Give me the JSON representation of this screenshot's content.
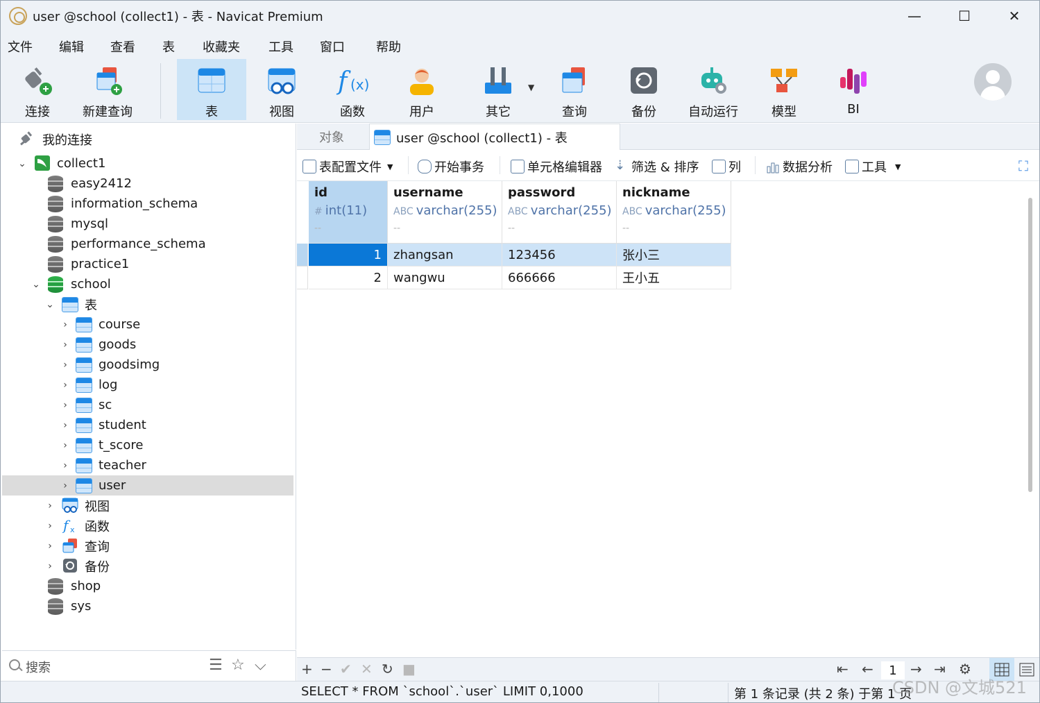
{
  "window": {
    "title": "user @school (collect1) - 表 - Navicat Premium",
    "controls": {
      "minimize": "—",
      "maximize": "☐",
      "close": "✕"
    }
  },
  "menu": [
    "文件",
    "编辑",
    "查看",
    "表",
    "收藏夹",
    "工具",
    "窗口",
    "帮助"
  ],
  "toolbar": {
    "buttons": [
      {
        "label": "连接",
        "icon": "connection-plug-icon"
      },
      {
        "label": "新建查询",
        "icon": "new-query-icon"
      },
      {
        "label": "表",
        "icon": "table-icon",
        "active": true
      },
      {
        "label": "视图",
        "icon": "view-icon"
      },
      {
        "label": "函数",
        "icon": "function-icon"
      },
      {
        "label": "用户",
        "icon": "user-icon"
      },
      {
        "label": "其它",
        "icon": "other-tools-icon"
      },
      {
        "label": "查询",
        "icon": "query-icon"
      },
      {
        "label": "备份",
        "icon": "backup-icon"
      },
      {
        "label": "自动运行",
        "icon": "robot-icon"
      },
      {
        "label": "模型",
        "icon": "model-icon"
      },
      {
        "label": "BI",
        "icon": "bi-icon"
      }
    ]
  },
  "sidebar": {
    "root_label": "我的连接",
    "connection": "collect1",
    "databases_before": [
      "easy2412",
      "information_schema",
      "mysql",
      "performance_schema",
      "practice1"
    ],
    "school": {
      "label": "school",
      "tables_label": "表",
      "tables": [
        "course",
        "goods",
        "goodsimg",
        "log",
        "sc",
        "student",
        "t_score",
        "teacher",
        "user"
      ],
      "selected_table": "user",
      "groups": [
        "视图",
        "函数",
        "查询",
        "备份"
      ]
    },
    "databases_after": [
      "shop",
      "sys"
    ],
    "search_label": "搜索"
  },
  "tabs": {
    "objects": "对象",
    "active": "user @school (collect1) - 表"
  },
  "subtoolbar": {
    "table_profile": "表配置文件",
    "begin_transaction": "开始事务",
    "cell_editor": "单元格编辑器",
    "filter_sort": "筛选 & 排序",
    "columns": "列",
    "data_analysis": "数据分析",
    "tools": "工具"
  },
  "grid": {
    "columns": [
      {
        "name": "id",
        "type_prefix": "#",
        "type": "int(11)",
        "dash": "--"
      },
      {
        "name": "username",
        "type_prefix": "ABC",
        "type": "varchar(255)",
        "dash": "--"
      },
      {
        "name": "password",
        "type_prefix": "ABC",
        "type": "varchar(255)",
        "dash": "--"
      },
      {
        "name": "nickname",
        "type_prefix": "ABC",
        "type": "varchar(255)",
        "dash": "--"
      }
    ],
    "rows": [
      {
        "id": "1",
        "username": "zhangsan",
        "password": "123456",
        "nickname": "张小三"
      },
      {
        "id": "2",
        "username": "wangwu",
        "password": "666666",
        "nickname": "王小五"
      }
    ]
  },
  "navbar": {
    "add": "+",
    "remove": "−",
    "apply": "✔",
    "discard": "✕",
    "refresh": "↻",
    "stop": "■",
    "first": "⇤",
    "prev": "←",
    "page": "1",
    "next": "→",
    "last": "⇥",
    "settings": "⚙"
  },
  "status": {
    "sql": "SELECT * FROM `school`.`user` LIMIT 0,1000",
    "records": "第 1 条记录 (共 2 条) 于第 1 页"
  },
  "watermark": "CSDN @文城521"
}
